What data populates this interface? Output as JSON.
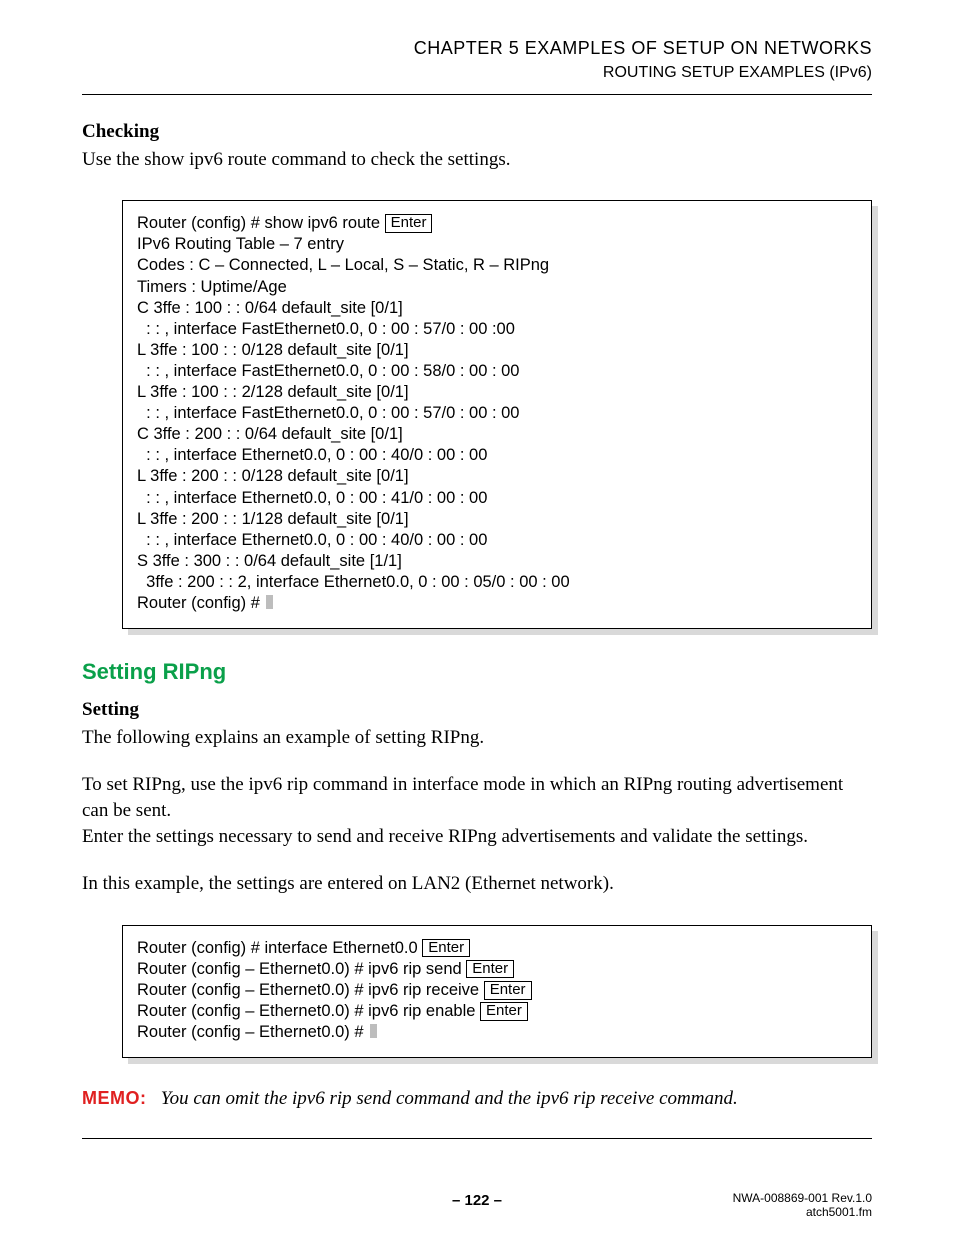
{
  "header": {
    "chapter": "CHAPTER 5   EXAMPLES OF SETUP ON NETWORKS",
    "section": "ROUTING SETUP EXAMPLES (IPv6)"
  },
  "checking": {
    "title": "Checking",
    "body": "Use the show ipv6 route command to check the settings."
  },
  "code1": {
    "l1a": "Router (config) # show ipv6 route ",
    "enter": "Enter",
    "l2": "IPv6 Routing Table – 7 entry",
    "l3": "Codes : C – Connected, L – Local, S – Static, R – RIPng",
    "l4": "Timers : Uptime/Age",
    "l5": "C 3ffe : 100 : : 0/64 default_site [0/1]",
    "l6": "  : : , interface FastEthernet0.0, 0 : 00 : 57/0 : 00 :00",
    "l7": "L 3ffe : 100 : : 0/128 default_site [0/1]",
    "l8": "  : : , interface FastEthernet0.0, 0 : 00 : 58/0 : 00 : 00",
    "l9": "L 3ffe : 100 : : 2/128 default_site [0/1]",
    "l10": "  : : , interface FastEthernet0.0, 0 : 00 : 57/0 : 00 : 00",
    "l11": "C 3ffe : 200 : : 0/64 default_site [0/1]",
    "l12": "  : : , interface Ethernet0.0, 0 : 00 : 40/0 : 00 : 00",
    "l13": "L 3ffe : 200 : : 0/128 default_site [0/1]",
    "l14": "  : : , interface Ethernet0.0, 0 : 00 : 41/0 : 00 : 00",
    "l15": "L 3ffe : 200 : : 1/128 default_site [0/1]",
    "l16": "  : : , interface Ethernet0.0, 0 : 00 : 40/0 : 00 : 00",
    "l17": "S 3ffe : 300 : : 0/64 default_site [1/1]",
    "l18": "  3ffe : 200 : : 2, interface Ethernet0.0, 0 : 00 : 05/0 : 00 : 00",
    "l19": "Router (config) # "
  },
  "ripng": {
    "heading": "Setting RIPng",
    "sub": "Setting",
    "p1": "The following explains an example of setting RIPng.",
    "p2": "To set RIPng, use the ipv6 rip command in interface mode in which an RIPng routing advertisement can be sent.",
    "p3": "Enter the settings necessary to send and receive RIPng advertisements and validate the settings.",
    "p4": "In this example, the settings are entered on LAN2 (Ethernet network)."
  },
  "code2": {
    "l1": "Router (config) # interface Ethernet0.0 ",
    "l2": "Router (config – Ethernet0.0) # ipv6 rip send ",
    "l3": "Router (config – Ethernet0.0) # ipv6 rip receive ",
    "l4": "Router (config – Ethernet0.0) # ipv6 rip enable ",
    "l5": "Router (config – Ethernet0.0) # ",
    "enter": "Enter"
  },
  "memo": {
    "label": "MEMO:",
    "text": "You can omit the ipv6 rip send command and the ipv6 rip receive command."
  },
  "footer": {
    "page": "– 122 –",
    "rev": "NWA-008869-001 Rev.1.0",
    "file": "atch5001.fm"
  }
}
